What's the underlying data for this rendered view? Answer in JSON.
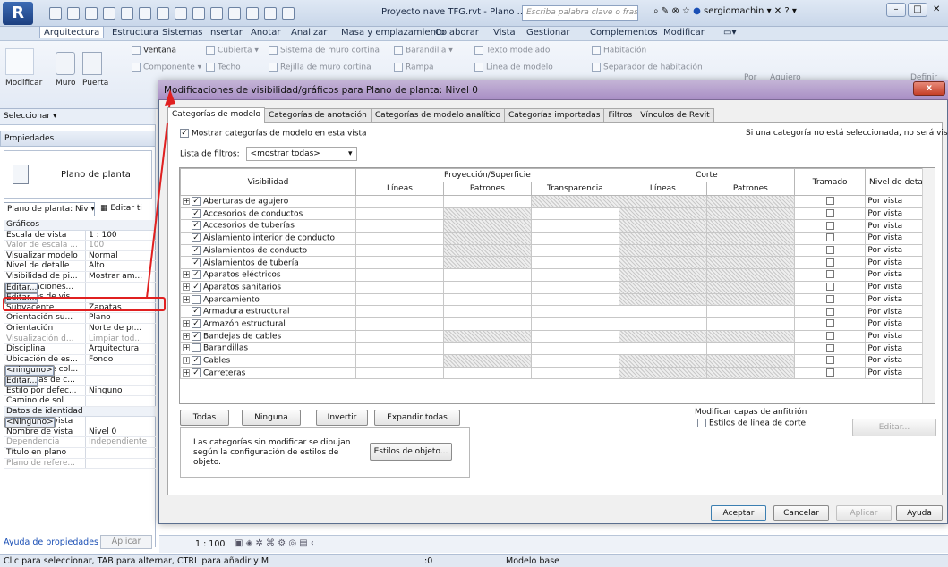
{
  "window": {
    "app_logo": "R",
    "doc_title": "Proyecto nave TFG.rvt - Plano ...",
    "search_placeholder": "Escriba palabra clave o frase",
    "user": "sergiomachin",
    "help": "?"
  },
  "menu": [
    "Arquitectura",
    "Estructura",
    "Sistemas",
    "Insertar",
    "Anotar",
    "Analizar",
    "Masa y emplazamiento",
    "Colaborar",
    "Vista",
    "Gestionar",
    "Complementos",
    "Modificar"
  ],
  "ribbon": {
    "modificar": "Modificar",
    "muro": "Muro",
    "puerta": "Puerta",
    "ventana": "Ventana",
    "componente": "Componente",
    "techo": "Techo",
    "cubierta": "Cubierta",
    "rejilla": "Rejilla de muro cortina",
    "sistema_muro": "Sistema de muro cortina",
    "rampa": "Rampa",
    "barandilla": "Barandilla",
    "texto_modelado": "Texto modelado",
    "linea_modelo": "Línea de modelo",
    "habitacion": "Habitación",
    "separador": "Separador de habitación",
    "por": "Por",
    "agujero": "Aguiero",
    "definir": "Definir"
  },
  "left": {
    "seleccionar": "Seleccionar ▾",
    "propiedades": "Propiedades",
    "type_name": "Plano de planta",
    "type_select": "Plano de planta: Niv ▾",
    "edit_type": "Editar ti",
    "sections": {
      "graficos": "Gráficos",
      "identidad": "Datos de identidad"
    },
    "graficos": [
      {
        "k": "Escala de vista",
        "v": "1 : 100",
        "btn": false,
        "gray": false
      },
      {
        "k": "Valor de escala ...",
        "v": "100",
        "btn": false,
        "gray": true
      },
      {
        "k": "Visualizar modelo",
        "v": "Normal",
        "btn": false,
        "gray": false
      },
      {
        "k": "Nivel de detalle",
        "v": "Alto",
        "btn": false,
        "gray": false
      },
      {
        "k": "Visibilidad de pi...",
        "v": "Mostrar am...",
        "btn": false,
        "gray": false
      },
      {
        "k": "Modificaciones...",
        "v": "Editar...",
        "btn": true,
        "gray": false
      },
      {
        "k": "Opciones de vis...",
        "v": "Editar...",
        "btn": true,
        "gray": false
      },
      {
        "k": "Subyacente",
        "v": "Zapatas",
        "btn": false,
        "gray": false
      },
      {
        "k": "Orientación su...",
        "v": "Plano",
        "btn": false,
        "gray": false
      },
      {
        "k": "Orientación",
        "v": "Norte de pr...",
        "btn": false,
        "gray": false
      },
      {
        "k": "Visualización d...",
        "v": "Limpiar tod...",
        "btn": false,
        "gray": true
      },
      {
        "k": "Disciplina",
        "v": "Arquitectura",
        "btn": false,
        "gray": false
      },
      {
        "k": "Ubicación de es...",
        "v": "Fondo",
        "btn": false,
        "gray": false
      },
      {
        "k": "Esquema de col...",
        "v": "<ninguno>",
        "btn": true,
        "gray": false
      },
      {
        "k": "Esquemas de c...",
        "v": "Editar...",
        "btn": true,
        "gray": false
      },
      {
        "k": "Estilo por defec...",
        "v": "Ninguno",
        "btn": false,
        "gray": false
      },
      {
        "k": "Camino de sol",
        "v": "",
        "btn": false,
        "gray": false
      }
    ],
    "identidad": [
      {
        "k": "Plantilla de vista",
        "v": "<Ninguno>",
        "btn": true,
        "gray": false
      },
      {
        "k": "Nombre de vista",
        "v": "Nivel 0",
        "btn": false,
        "gray": false
      },
      {
        "k": "Dependencia",
        "v": "Independiente",
        "btn": false,
        "gray": true
      },
      {
        "k": "Título en plano",
        "v": "",
        "btn": false,
        "gray": false
      },
      {
        "k": "Plano de refere...",
        "v": "",
        "btn": false,
        "gray": true
      }
    ],
    "help_link": "Ayuda de propiedades",
    "apply": "Aplicar"
  },
  "scale": "1 : 100",
  "status": "Clic para seleccionar, TAB para alternar, CTRL para añadir y M",
  "status_zero": ":0",
  "status_model": "Modelo base",
  "dialog": {
    "title": "Modificaciones de visibilidad/gráficos para Plano de planta: Nivel 0",
    "close": "x",
    "tabs": [
      "Categorías de modelo",
      "Categorías de anotación",
      "Categorías de modelo analítico",
      "Categorías importadas",
      "Filtros",
      "Vínculos de Revit"
    ],
    "show_check": "Mostrar categorías de modelo en esta vista",
    "right_note": "Si una categoría no está seleccionada, no será visible.",
    "filter_label": "Lista de filtros:",
    "filter_value": "<mostrar todas>",
    "headers": {
      "visibilidad": "Visibilidad",
      "proyeccion": "Proyección/Superficie",
      "corte": "Corte",
      "tramado": "Tramado",
      "nivel": "Nivel de detalle",
      "lineas": "Líneas",
      "patrones": "Patrones",
      "transparencia": "Transparencia",
      "lineas2": "Líneas",
      "patrones2": "Patrones"
    },
    "rows": [
      {
        "name": "Aberturas de agujero",
        "exp": true,
        "checked": true,
        "nivel": "Por vista",
        "h": [
          0,
          0,
          1,
          1,
          1
        ]
      },
      {
        "name": "Accesorios de conductos",
        "exp": false,
        "checked": true,
        "nivel": "Por vista",
        "h": [
          0,
          1,
          0,
          1,
          1
        ]
      },
      {
        "name": "Accesorios de tuberías",
        "exp": false,
        "checked": true,
        "nivel": "Por vista",
        "h": [
          0,
          1,
          0,
          1,
          1
        ]
      },
      {
        "name": "Aislamiento interior de conducto",
        "exp": false,
        "checked": true,
        "nivel": "Por vista",
        "h": [
          0,
          1,
          0,
          1,
          1
        ]
      },
      {
        "name": "Aislamientos de conducto",
        "exp": false,
        "checked": true,
        "nivel": "Por vista",
        "h": [
          0,
          1,
          0,
          1,
          1
        ]
      },
      {
        "name": "Aislamientos de tubería",
        "exp": false,
        "checked": true,
        "nivel": "Por vista",
        "h": [
          0,
          1,
          0,
          1,
          1
        ]
      },
      {
        "name": "Aparatos eléctricos",
        "exp": true,
        "checked": true,
        "nivel": "Por vista",
        "h": [
          0,
          0,
          0,
          1,
          1
        ]
      },
      {
        "name": "Aparatos sanitarios",
        "exp": true,
        "checked": true,
        "nivel": "Por vista",
        "h": [
          0,
          0,
          0,
          1,
          1
        ]
      },
      {
        "name": "Aparcamiento",
        "exp": true,
        "checked": false,
        "nivel": "Por vista",
        "h": [
          0,
          0,
          0,
          1,
          1
        ]
      },
      {
        "name": "Armadura estructural",
        "exp": false,
        "checked": true,
        "nivel": "Por vista",
        "h": [
          0,
          0,
          0,
          0,
          0
        ]
      },
      {
        "name": "Armazón estructural",
        "exp": true,
        "checked": true,
        "nivel": "Por vista",
        "h": [
          0,
          0,
          0,
          0,
          0
        ]
      },
      {
        "name": "Bandejas de cables",
        "exp": true,
        "checked": true,
        "nivel": "Por vista",
        "h": [
          0,
          1,
          0,
          1,
          1
        ]
      },
      {
        "name": "Barandillas",
        "exp": true,
        "checked": false,
        "nivel": "Por vista",
        "h": [
          0,
          0,
          0,
          0,
          0
        ]
      },
      {
        "name": "Cables",
        "exp": true,
        "checked": true,
        "nivel": "Por vista",
        "h": [
          0,
          1,
          0,
          1,
          1
        ]
      },
      {
        "name": "Carreteras",
        "exp": true,
        "checked": true,
        "nivel": "Por vista",
        "h": [
          0,
          0,
          0,
          1,
          1
        ]
      }
    ],
    "btn_todas": "Todas",
    "btn_ninguna": "Ninguna",
    "btn_invertir": "Invertir",
    "btn_expandir": "Expandir todas",
    "host_title": "Modificar capas de anfitrión",
    "host_check": "Estilos de línea de corte",
    "host_edit": "Editar...",
    "note": "Las categorías sin modificar se dibujan según la configuración de estilos de objeto.",
    "btn_estilos": "Estilos de objeto...",
    "btn_aceptar": "Aceptar",
    "btn_cancelar": "Cancelar",
    "btn_aplicar": "Aplicar",
    "btn_ayuda": "Ayuda"
  },
  "colors": {
    "highlight_red": "#e02020",
    "dialog_title": "#a98fc5",
    "accent": "#1a4fb5"
  }
}
